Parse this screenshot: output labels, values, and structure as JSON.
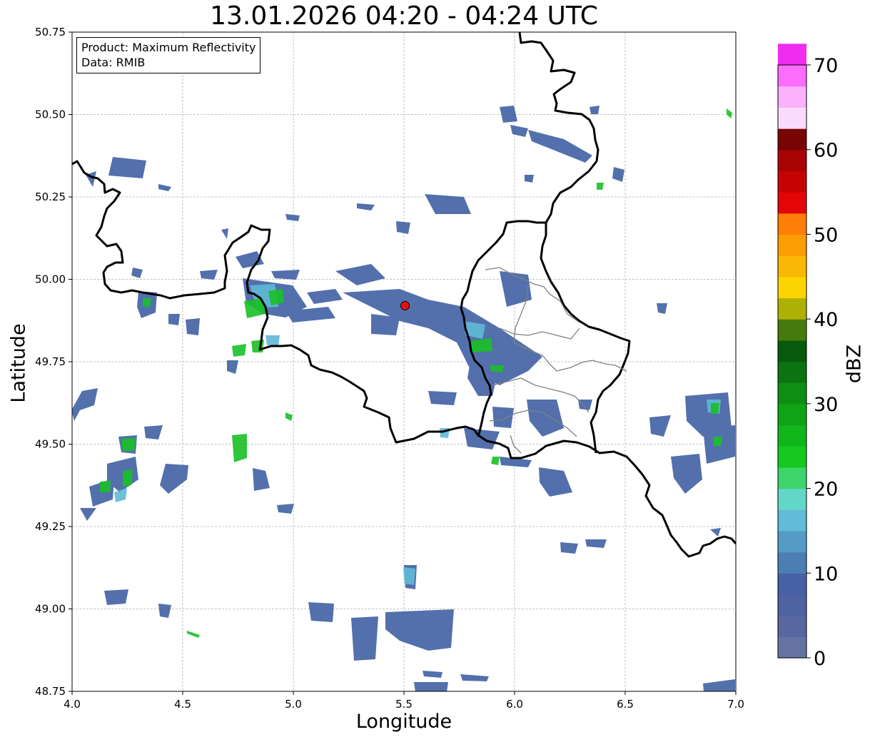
{
  "title": "13.01.2026 04:20 - 04:24 UTC",
  "info": {
    "product": "Product: Maximum Reflectivity",
    "data": "Data: RMIB"
  },
  "axes": {
    "xlabel": "Longitude",
    "ylabel": "Latitude",
    "xlim": [
      4.0,
      7.0
    ],
    "ylim": [
      48.75,
      50.75
    ],
    "xticks": [
      "4.0",
      "4.5",
      "5.0",
      "5.5",
      "6.0",
      "6.5",
      "7.0"
    ],
    "yticks": [
      "48.75",
      "49.00",
      "49.25",
      "49.50",
      "49.75",
      "50.00",
      "50.25",
      "50.50",
      "50.75"
    ],
    "grid": true
  },
  "colorbar": {
    "label": "dBZ",
    "range": [
      0,
      70
    ],
    "step": 2.5,
    "ticks": [
      "0",
      "10",
      "20",
      "30",
      "40",
      "50",
      "60",
      "70"
    ],
    "colors": [
      "#6573a3",
      "#5967a1",
      "#4f62a2",
      "#4661a5",
      "#4b7fb4",
      "#549cc6",
      "#62bbd8",
      "#63d7c7",
      "#3dd46a",
      "#15c91f",
      "#11b61a",
      "#0fa316",
      "#0e8e13",
      "#0b7410",
      "#075a0c",
      "#477a0c",
      "#afb006",
      "#fcd404",
      "#fbb706",
      "#fd9d05",
      "#fe7e07",
      "#e40508",
      "#c60404",
      "#a80404",
      "#780404",
      "#fbdbfd",
      "#fcb1fc",
      "#fc6dfc",
      "#ef2cef"
    ]
  },
  "marker": {
    "lon": 5.505,
    "lat": 49.92,
    "color": "#e81010"
  },
  "colors": {
    "border": "#000000",
    "province": "#7f7f7f"
  }
}
